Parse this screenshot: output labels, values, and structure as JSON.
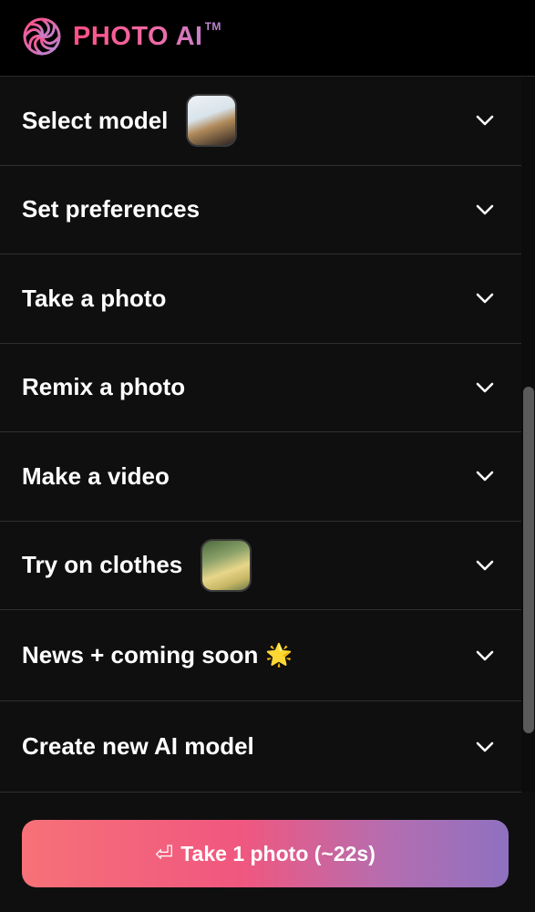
{
  "header": {
    "logo_text": "PHOTO AI",
    "logo_tm": "TM"
  },
  "menu": {
    "items": [
      {
        "label": "Select model",
        "thumbnail": "model-photo"
      },
      {
        "label": "Set preferences"
      },
      {
        "label": "Take a photo"
      },
      {
        "label": "Remix a photo"
      },
      {
        "label": "Make a video"
      },
      {
        "label": "Try on clothes",
        "thumbnail": "clothes-photo"
      },
      {
        "label": "News + coming soon",
        "emoji": "🌟"
      },
      {
        "label": "Create new AI model"
      }
    ]
  },
  "cta": {
    "icon": "⏎",
    "label": "Take 1 photo (~22s)"
  },
  "colors": {
    "brand_pink": "#ff4f86",
    "brand_purple": "#b887d4",
    "cta_start": "#f77178",
    "cta_end": "#8e71c0"
  }
}
